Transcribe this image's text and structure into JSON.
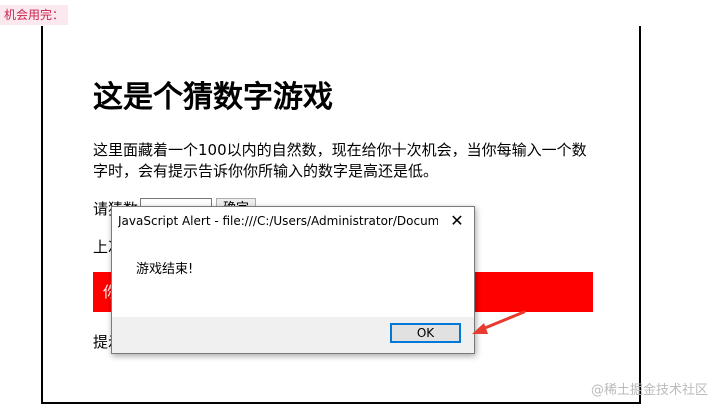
{
  "top_caption": "机会用完：",
  "page": {
    "heading": "这是个猜数字游戏",
    "intro": "这里面藏着一个100以内的自然数，现在给你十次机会，当你每输入一个数字时，会有提示告诉你你所输入的数字是高还是低。",
    "guess_label": "请猜数",
    "submit_label": "确定",
    "prev_guesses_label": "上次猜的数",
    "result_text": "你",
    "hint_label": "提示"
  },
  "alert": {
    "title": "JavaScript Alert - file:///C:/Users/Administrator/Docum...",
    "message": "游戏结束!",
    "ok_label": "OK",
    "close_glyph": "✕"
  },
  "annotation": {
    "arrow_color": "#e83a2e"
  },
  "watermark": "@稀土掘金技术社区",
  "colors": {
    "result_bar": "#ff0000",
    "ok_border": "#0078d7"
  }
}
